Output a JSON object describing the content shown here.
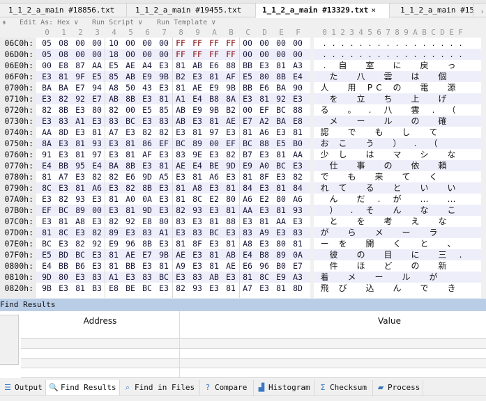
{
  "tabs": [
    {
      "label": "1_1_2_a_main #18856.txt"
    },
    {
      "label": "1_1_2_a_main #19455.txt"
    },
    {
      "label": "1_1_2_a_main #13329.txt",
      "active": true,
      "close": "×"
    },
    {
      "label": "1_1_2_a_main #15"
    }
  ],
  "tab_nav": {
    "prev": "‹",
    "next": "›"
  },
  "toolbar": {
    "edit_as": "Edit As: Hex ∨",
    "run_script": "Run Script ∨",
    "run_template": "Run Template ∨",
    "collapse": "⇟"
  },
  "columns": [
    "0",
    "1",
    "2",
    "3",
    "4",
    "5",
    "6",
    "7",
    "8",
    "9",
    "A",
    "B",
    "C",
    "D",
    "E",
    "F"
  ],
  "rows": [
    {
      "addr": "06C0h:",
      "hex": "05 08 00 00 10 00 00 00 FF FF FF FF 00 00 00 00",
      "text": "................"
    },
    {
      "addr": "06D0h:",
      "hex": "05 08 00 00 18 00 00 00 FF FF FF FF 00 00 00 00",
      "text": "................"
    },
    {
      "addr": "06E0h:",
      "hex": "00 E8 87 AA E5 AE A4 E3 81 AB E6 88 BB E3 81 A3",
      "text": ". 自  室  に  戻  っ "
    },
    {
      "addr": "06F0h:",
      "hex": "E3 81 9F E5 85 AB E9 9B B2 E3 81 AF E5 80 8B E4",
      "text": " た  八  雲  は  個  "
    },
    {
      "addr": "0700h:",
      "hex": "BA BA E7 94 A8 50 43 E3 81 AE E9 9B BB E6 BA 90",
      "text": "人  用 PC の  電  源 "
    },
    {
      "addr": "0710h:",
      "hex": "E3 82 92 E7 AB 8B E3 81 A1 E4 B8 8A E3 81 92 E3",
      "text": " を  立  ち  上  げ  "
    },
    {
      "addr": "0720h:",
      "hex": "82 8B E3 80 82 00 E5 85 AB E9 9B B2 00 EF BC 88",
      "text": "る  。 . 八  雲 . （ "
    },
    {
      "addr": "0730h:",
      "hex": "E3 83 A1 E3 83 BC E3 83 AB E3 81 AE E7 A2 BA E8",
      "text": " メ  ー  ル  の  確  "
    },
    {
      "addr": "0740h:",
      "hex": "AA 8D E3 81 A7 E3 82 82 E3 81 97 E3 81 A6 E3 81",
      "text": "認  で  も  し  て   "
    },
    {
      "addr": "0750h:",
      "hex": "8A E3 81 93 E3 81 86 EF BC 89 00 EF BC 88 E5 B0",
      "text": "お こ  う  ） . （   "
    },
    {
      "addr": "0760h:",
      "hex": "91 E3 81 97 E3 81 AF E3 83 9E E3 82 B7 E3 81 AA",
      "text": "少 し  は  マ  シ  な "
    },
    {
      "addr": "0770h:",
      "hex": "E4 BB 95 E4 BA 8B E3 81 AE E4 BE 9D E9 A0 BC E3",
      "text": " 仕  事  の  依  頼  "
    },
    {
      "addr": "0780h:",
      "hex": "81 A7 E3 82 82 E6 9D A5 E3 81 A6 E3 81 8F E3 82",
      "text": "で  も  来  て  く   "
    },
    {
      "addr": "0790h:",
      "hex": "8C E3 81 A6 E3 82 8B E3 81 A8 E3 81 84 E3 81 84",
      "text": "れ て  る  と  い  い "
    },
    {
      "addr": "07A0h:",
      "hex": "E3 82 93 E3 81 A0 0A E3 81 8C E2 80 A6 E2 80 A6",
      "text": " ん  だ . が  …  … "
    },
    {
      "addr": "07B0h:",
      "hex": "EF BC 89 00 E3 81 9D E3 82 93 E3 81 AA E3 81 93",
      "text": " ） . そ  ん  な  こ "
    },
    {
      "addr": "07C0h:",
      "hex": "E3 81 A8 E3 82 92 E8 80 83 E3 81 88 E3 81 AA E3",
      "text": " と  を  考  え  な  "
    },
    {
      "addr": "07D0h:",
      "hex": "81 8C E3 82 89 E3 83 A1 E3 83 BC E3 83 A9 E3 83",
      "text": "が  ら  メ  ー  ラ   "
    },
    {
      "addr": "07E0h:",
      "hex": "BC E3 82 92 E9 96 8B E3 81 8F E3 81 A8 E3 80 81",
      "text": "ー を  開  く  と  、 "
    },
    {
      "addr": "07F0h:",
      "hex": "E5 BD BC E3 81 AE E7 9B AE E3 81 AB E4 B8 89 0A",
      "text": " 彼  の  目  に  三 ."
    },
    {
      "addr": "0800h:",
      "hex": "E4 BB B6 E3 81 BB E3 81 A9 E3 81 AE E6 96 B0 E7",
      "text": " 件  ほ  ど  の  新  "
    },
    {
      "addr": "0810h:",
      "hex": "9D 80 E3 83 A1 E3 83 BC E3 83 AB E3 81 8C E9 A3",
      "text": "着  メ  ー  ル  が   "
    },
    {
      "addr": "0820h:",
      "hex": "9B E3 81 B3 E8 BE BC E3 82 93 E3 81 A7 E3 81 8D",
      "text": "飛 び  込  ん  で  き "
    }
  ],
  "find_results": {
    "title": "Find Results",
    "columns": {
      "address": "Address",
      "value": "Value"
    }
  },
  "bottom_tabs": [
    {
      "label": "Output",
      "icon": "output-icon",
      "glyph": "☰"
    },
    {
      "label": "Find Results",
      "icon": "magnifier-icon",
      "glyph": "🔍",
      "active": true
    },
    {
      "label": "Find in Files",
      "icon": "find-in-files-icon",
      "glyph": "⌕"
    },
    {
      "label": "Compare",
      "icon": "compare-icon",
      "glyph": "?"
    },
    {
      "label": "Histogram",
      "icon": "histogram-icon",
      "glyph": "▟"
    },
    {
      "label": "Checksum",
      "icon": "sigma-icon",
      "glyph": "Σ"
    },
    {
      "label": "Process",
      "icon": "chip-icon",
      "glyph": "▰"
    }
  ],
  "colors": {
    "accent": "#b9cde6",
    "ff_byte": "#800000",
    "row_alt": "#eeeefb"
  }
}
